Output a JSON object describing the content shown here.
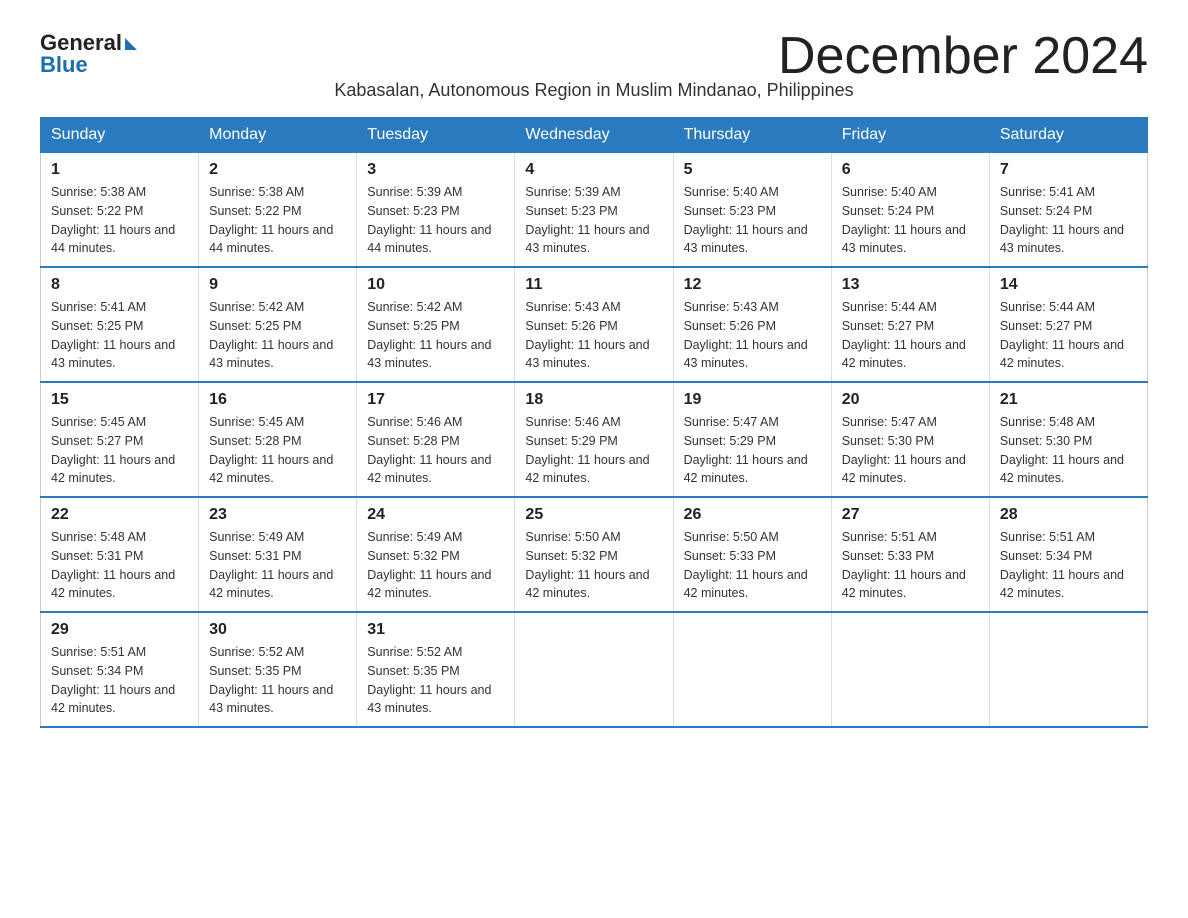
{
  "logo": {
    "general": "General",
    "blue": "Blue"
  },
  "title": "December 2024",
  "subtitle": "Kabasalan, Autonomous Region in Muslim Mindanao, Philippines",
  "days_of_week": [
    "Sunday",
    "Monday",
    "Tuesday",
    "Wednesday",
    "Thursday",
    "Friday",
    "Saturday"
  ],
  "weeks": [
    [
      {
        "day": "1",
        "sunrise": "5:38 AM",
        "sunset": "5:22 PM",
        "daylight": "11 hours and 44 minutes."
      },
      {
        "day": "2",
        "sunrise": "5:38 AM",
        "sunset": "5:22 PM",
        "daylight": "11 hours and 44 minutes."
      },
      {
        "day": "3",
        "sunrise": "5:39 AM",
        "sunset": "5:23 PM",
        "daylight": "11 hours and 44 minutes."
      },
      {
        "day": "4",
        "sunrise": "5:39 AM",
        "sunset": "5:23 PM",
        "daylight": "11 hours and 43 minutes."
      },
      {
        "day": "5",
        "sunrise": "5:40 AM",
        "sunset": "5:23 PM",
        "daylight": "11 hours and 43 minutes."
      },
      {
        "day": "6",
        "sunrise": "5:40 AM",
        "sunset": "5:24 PM",
        "daylight": "11 hours and 43 minutes."
      },
      {
        "day": "7",
        "sunrise": "5:41 AM",
        "sunset": "5:24 PM",
        "daylight": "11 hours and 43 minutes."
      }
    ],
    [
      {
        "day": "8",
        "sunrise": "5:41 AM",
        "sunset": "5:25 PM",
        "daylight": "11 hours and 43 minutes."
      },
      {
        "day": "9",
        "sunrise": "5:42 AM",
        "sunset": "5:25 PM",
        "daylight": "11 hours and 43 minutes."
      },
      {
        "day": "10",
        "sunrise": "5:42 AM",
        "sunset": "5:25 PM",
        "daylight": "11 hours and 43 minutes."
      },
      {
        "day": "11",
        "sunrise": "5:43 AM",
        "sunset": "5:26 PM",
        "daylight": "11 hours and 43 minutes."
      },
      {
        "day": "12",
        "sunrise": "5:43 AM",
        "sunset": "5:26 PM",
        "daylight": "11 hours and 43 minutes."
      },
      {
        "day": "13",
        "sunrise": "5:44 AM",
        "sunset": "5:27 PM",
        "daylight": "11 hours and 42 minutes."
      },
      {
        "day": "14",
        "sunrise": "5:44 AM",
        "sunset": "5:27 PM",
        "daylight": "11 hours and 42 minutes."
      }
    ],
    [
      {
        "day": "15",
        "sunrise": "5:45 AM",
        "sunset": "5:27 PM",
        "daylight": "11 hours and 42 minutes."
      },
      {
        "day": "16",
        "sunrise": "5:45 AM",
        "sunset": "5:28 PM",
        "daylight": "11 hours and 42 minutes."
      },
      {
        "day": "17",
        "sunrise": "5:46 AM",
        "sunset": "5:28 PM",
        "daylight": "11 hours and 42 minutes."
      },
      {
        "day": "18",
        "sunrise": "5:46 AM",
        "sunset": "5:29 PM",
        "daylight": "11 hours and 42 minutes."
      },
      {
        "day": "19",
        "sunrise": "5:47 AM",
        "sunset": "5:29 PM",
        "daylight": "11 hours and 42 minutes."
      },
      {
        "day": "20",
        "sunrise": "5:47 AM",
        "sunset": "5:30 PM",
        "daylight": "11 hours and 42 minutes."
      },
      {
        "day": "21",
        "sunrise": "5:48 AM",
        "sunset": "5:30 PM",
        "daylight": "11 hours and 42 minutes."
      }
    ],
    [
      {
        "day": "22",
        "sunrise": "5:48 AM",
        "sunset": "5:31 PM",
        "daylight": "11 hours and 42 minutes."
      },
      {
        "day": "23",
        "sunrise": "5:49 AM",
        "sunset": "5:31 PM",
        "daylight": "11 hours and 42 minutes."
      },
      {
        "day": "24",
        "sunrise": "5:49 AM",
        "sunset": "5:32 PM",
        "daylight": "11 hours and 42 minutes."
      },
      {
        "day": "25",
        "sunrise": "5:50 AM",
        "sunset": "5:32 PM",
        "daylight": "11 hours and 42 minutes."
      },
      {
        "day": "26",
        "sunrise": "5:50 AM",
        "sunset": "5:33 PM",
        "daylight": "11 hours and 42 minutes."
      },
      {
        "day": "27",
        "sunrise": "5:51 AM",
        "sunset": "5:33 PM",
        "daylight": "11 hours and 42 minutes."
      },
      {
        "day": "28",
        "sunrise": "5:51 AM",
        "sunset": "5:34 PM",
        "daylight": "11 hours and 42 minutes."
      }
    ],
    [
      {
        "day": "29",
        "sunrise": "5:51 AM",
        "sunset": "5:34 PM",
        "daylight": "11 hours and 42 minutes."
      },
      {
        "day": "30",
        "sunrise": "5:52 AM",
        "sunset": "5:35 PM",
        "daylight": "11 hours and 43 minutes."
      },
      {
        "day": "31",
        "sunrise": "5:52 AM",
        "sunset": "5:35 PM",
        "daylight": "11 hours and 43 minutes."
      },
      null,
      null,
      null,
      null
    ]
  ]
}
